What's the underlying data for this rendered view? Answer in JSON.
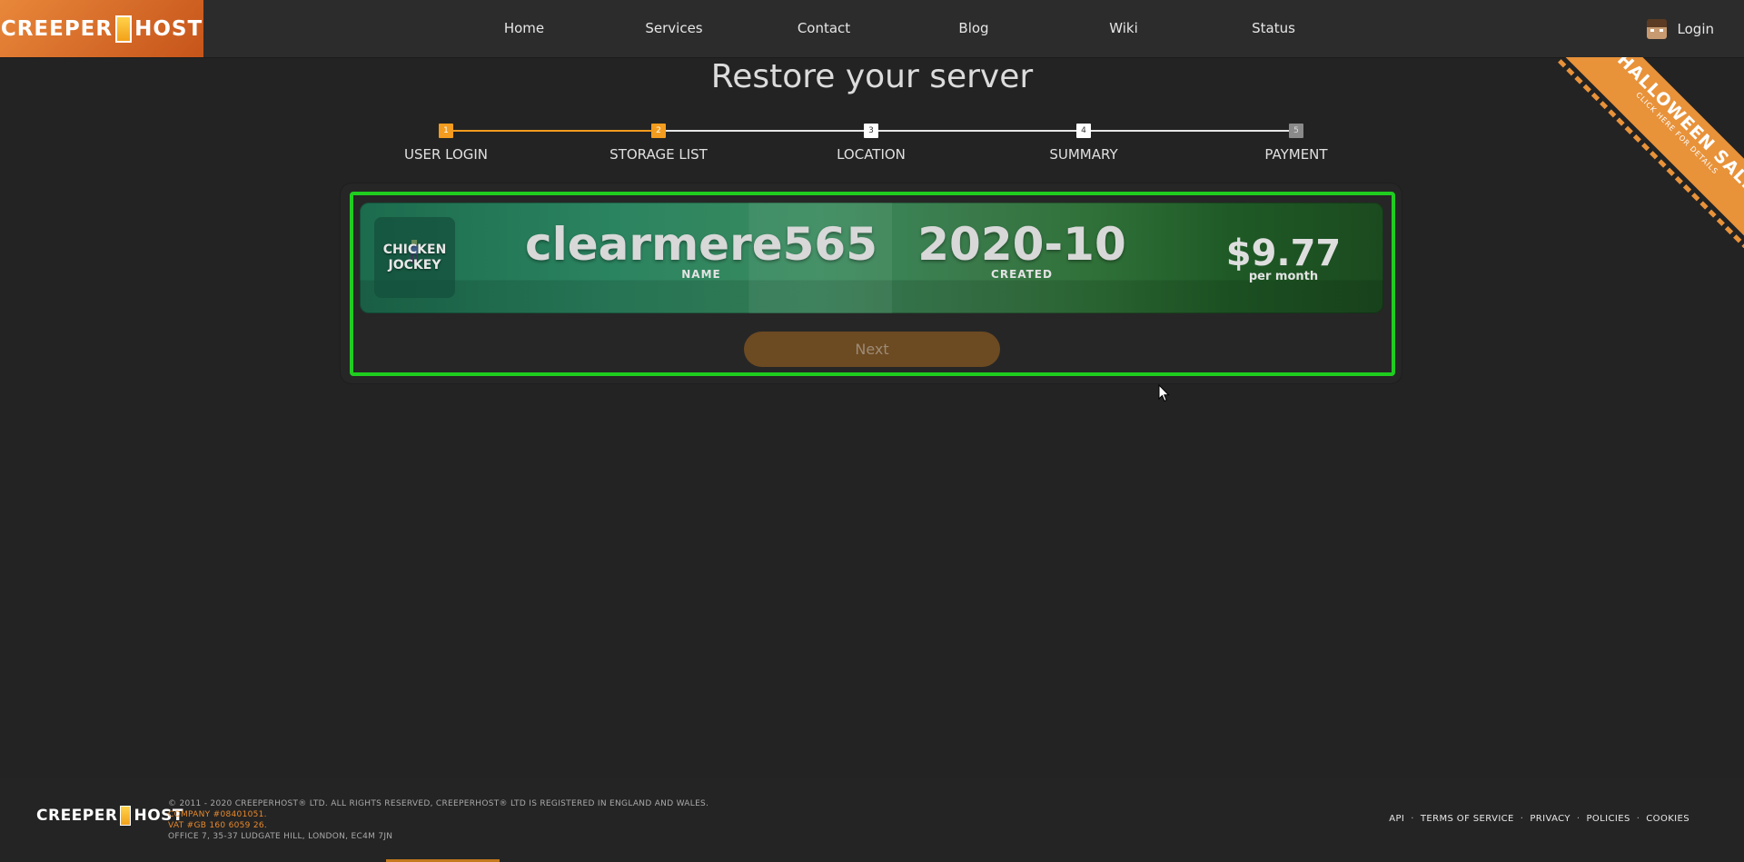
{
  "brand": {
    "logo_left": "CREEPER",
    "logo_right": "HOST"
  },
  "nav": {
    "links": [
      "Home",
      "Services",
      "Contact",
      "Blog",
      "Wiki",
      "Status"
    ],
    "login_label": "Login"
  },
  "promo": {
    "title": "HALLOWEEN SALE",
    "subtitle": "CLICK HERE FOR DETAILS"
  },
  "page": {
    "title": "Restore your server"
  },
  "stepper": {
    "current_step": 2,
    "steps": [
      {
        "number": "1",
        "label": "USER LOGIN"
      },
      {
        "number": "2",
        "label": "STORAGE LIST"
      },
      {
        "number": "3",
        "label": "LOCATION"
      },
      {
        "number": "4",
        "label": "SUMMARY"
      },
      {
        "number": "5",
        "label": "PAYMENT"
      }
    ]
  },
  "server": {
    "mob_line1": "CHICKEN",
    "mob_line2": "JOCKEY",
    "name_value": "clearmere565",
    "name_label": "NAME",
    "created_value": "2020-10",
    "created_label": "CREATED",
    "price_value": "$9.77",
    "price_period": "per month"
  },
  "actions": {
    "next_label": "Next"
  },
  "footer": {
    "logo_left": "CREEPER",
    "logo_right": "HOST",
    "copyright": "© 2011 - 2020 CREEPERHOST® LTD. ALL RIGHTS RESERVED, CREEPERHOST® LTD IS REGISTERED IN ENGLAND AND WALES.",
    "company": "COMPANY #08401051.",
    "vat": "VAT #GB 160 6059 26.",
    "address": "OFFICE 7, 35-37 LUDGATE HILL, LONDON, EC4M 7JN",
    "links": [
      "API",
      "TERMS OF SERVICE",
      "PRIVACY",
      "POLICIES",
      "COOKIES"
    ]
  },
  "colors": {
    "accent_orange": "#f39c1f",
    "highlight_green": "#1fcd1f",
    "background": "#232323",
    "next_button": "#6c4a22"
  }
}
